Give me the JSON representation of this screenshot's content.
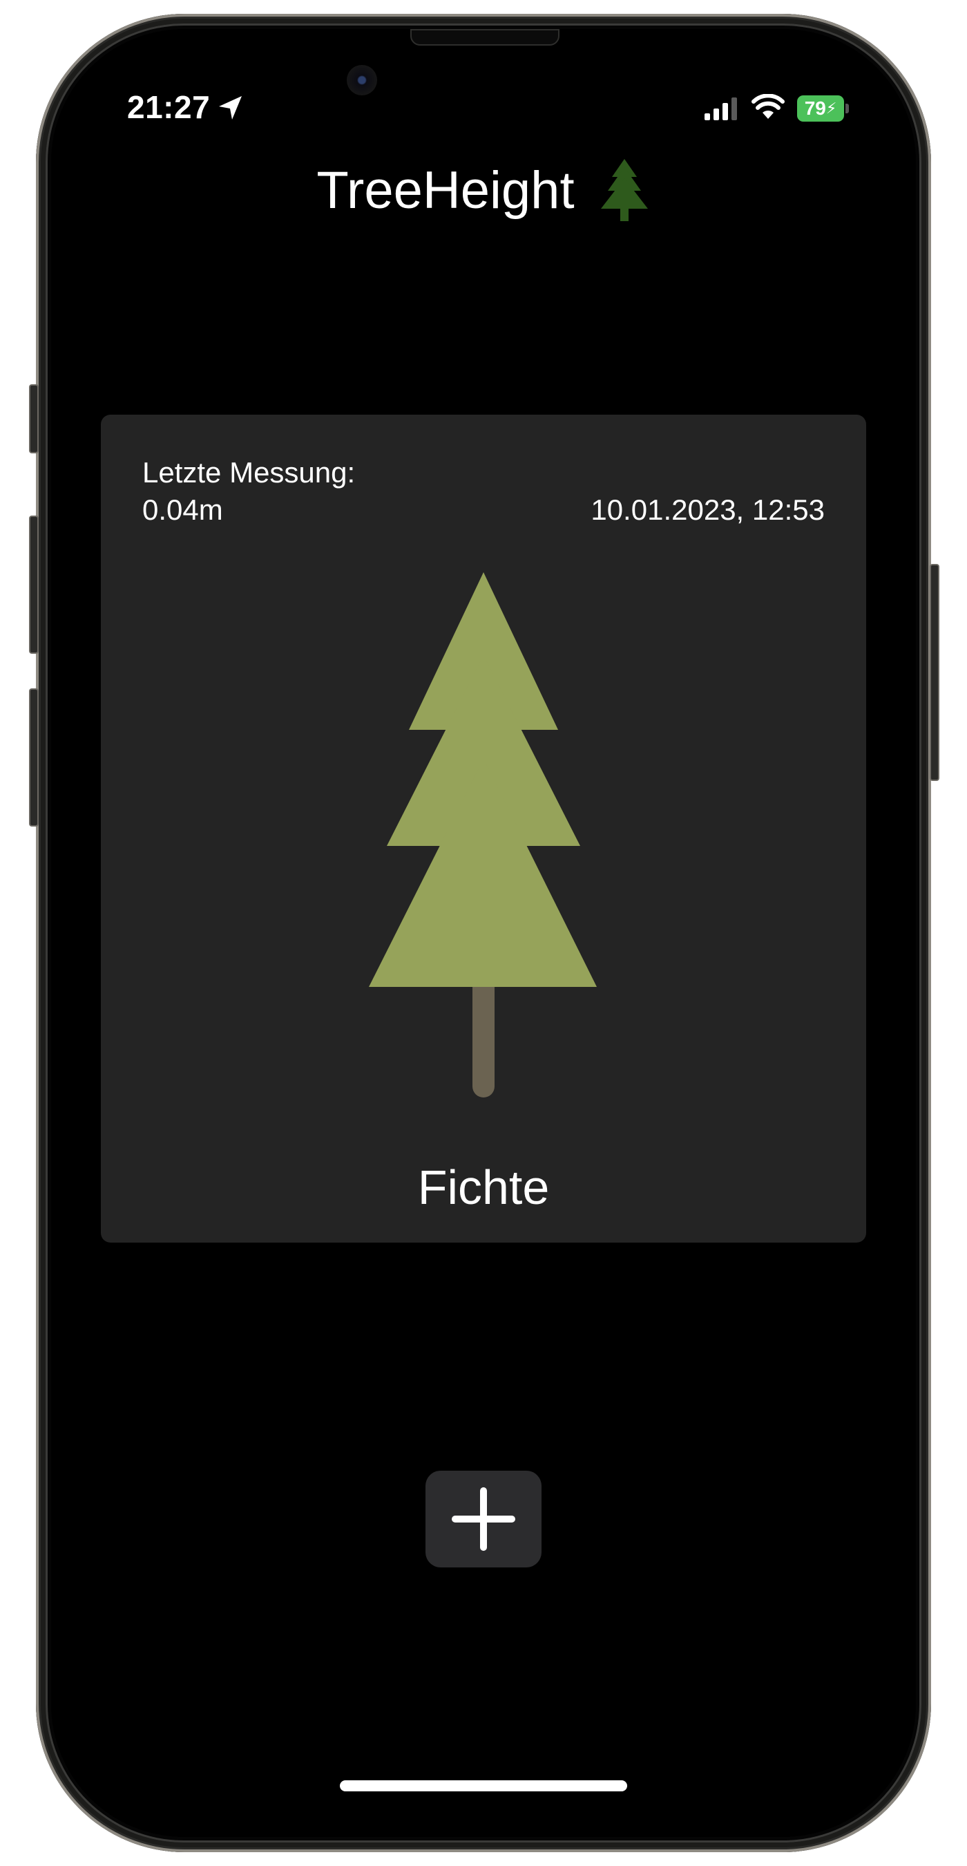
{
  "status_bar": {
    "time": "21:27",
    "battery_percent": "79",
    "icons": [
      "location-arrow-icon",
      "cellular-signal-icon",
      "wifi-icon",
      "battery-charging-icon"
    ]
  },
  "header": {
    "title": "TreeHeight",
    "icon": "evergreen-tree-icon"
  },
  "measurement_card": {
    "label": "Letzte Messung:",
    "height_value": "0.04m",
    "timestamp": "10.01.2023, 12:53",
    "tree_type": "Fichte",
    "tree_icon": "spruce-tree-icon"
  },
  "actions": {
    "add_icon": "plus-icon"
  },
  "colors": {
    "background": "#000000",
    "card": "#242424",
    "tree_foliage": "#96a35a",
    "tree_trunk": "#6b6351",
    "title_tree": "#2e5a1c",
    "battery": "#4cc15a",
    "add_button": "#2c2c2e"
  }
}
